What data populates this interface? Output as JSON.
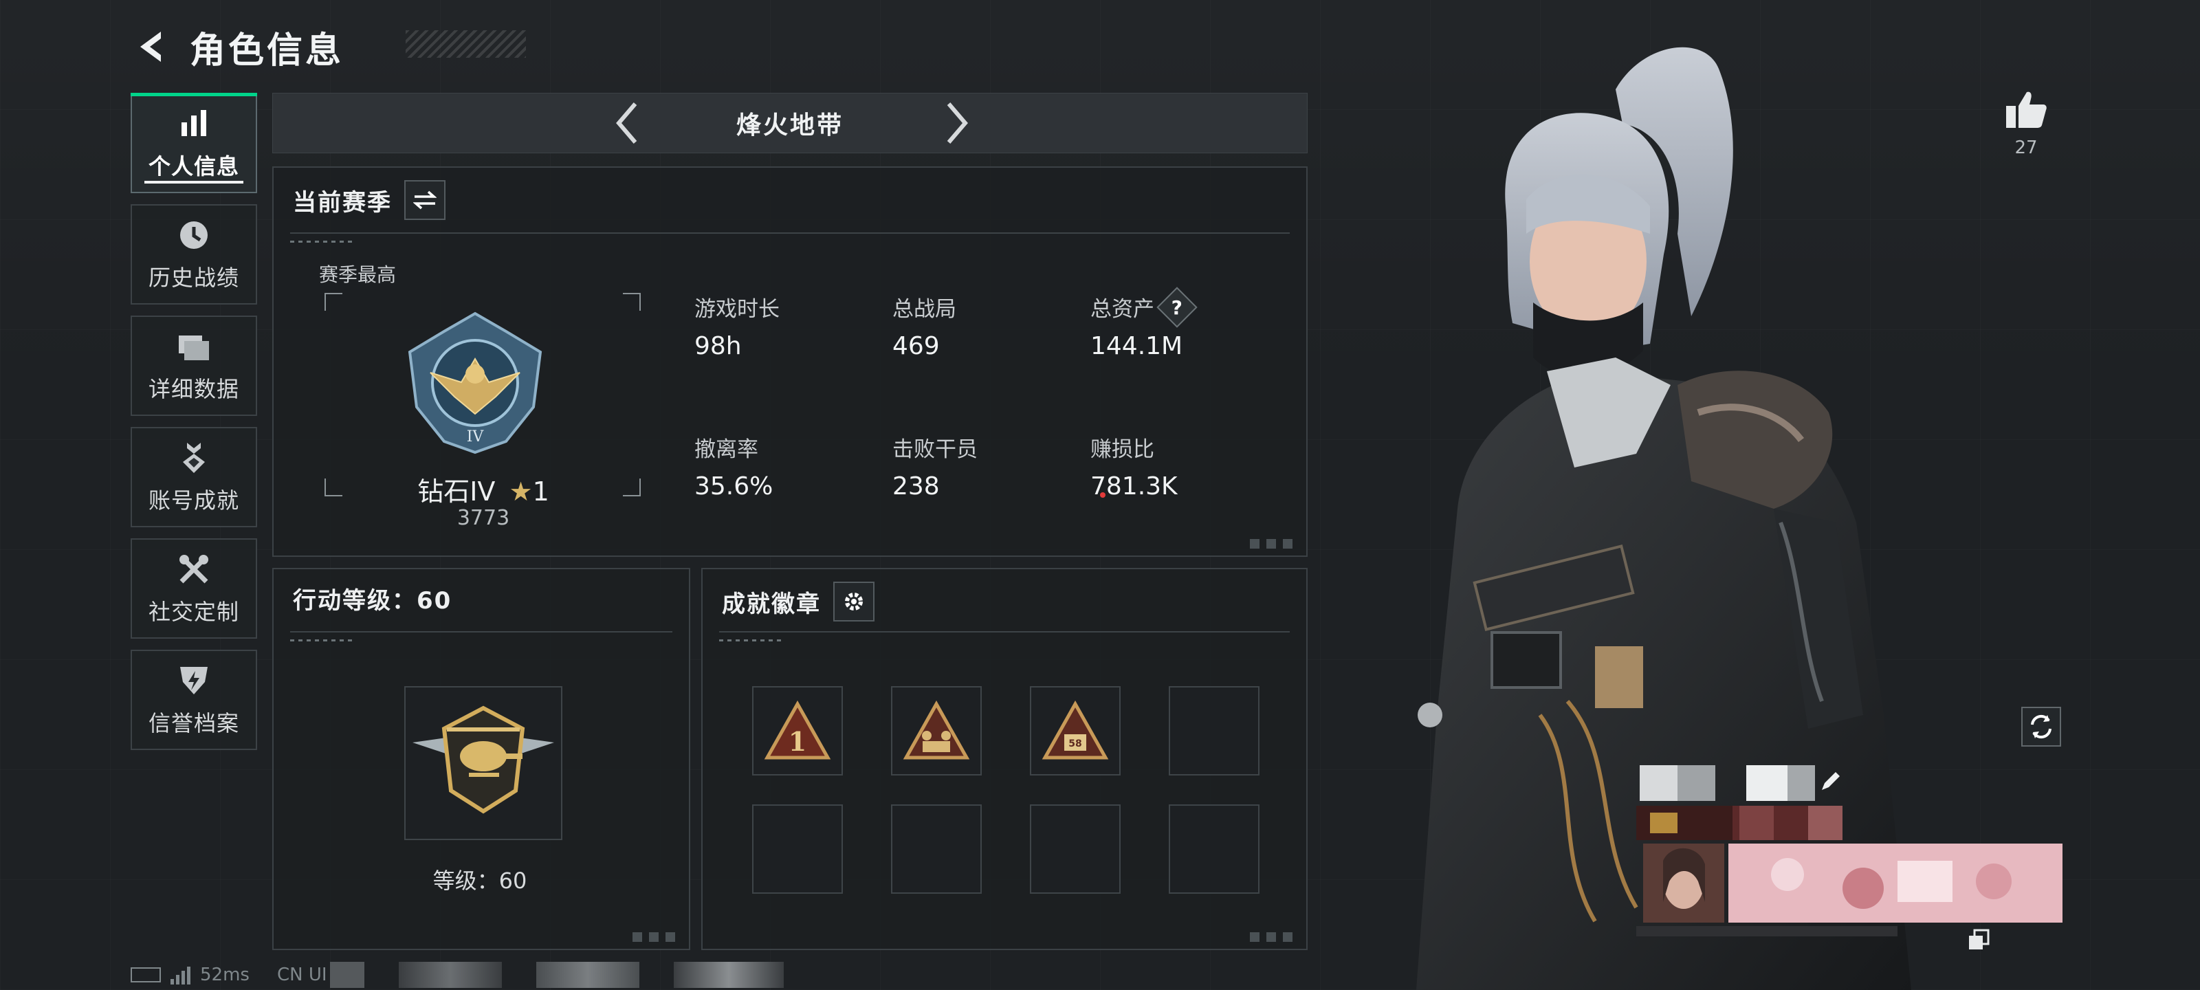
{
  "header": {
    "title": "角色信息",
    "back_icon": "back-arrow-icon"
  },
  "sidebar": {
    "items": [
      {
        "label": "个人信息",
        "icon": "bar-chart-icon",
        "active": true
      },
      {
        "label": "历史战绩",
        "icon": "clock-icon",
        "active": false
      },
      {
        "label": "详细数据",
        "icon": "folder-icon",
        "active": false
      },
      {
        "label": "账号成就",
        "icon": "medal-icon",
        "active": false
      },
      {
        "label": "社交定制",
        "icon": "wrench-icon",
        "active": false
      },
      {
        "label": "信誉档案",
        "icon": "shield-icon",
        "active": false
      }
    ]
  },
  "mode": {
    "title": "烽火地带"
  },
  "season": {
    "title": "当前赛季",
    "best_label": "赛季最高",
    "rank_name": "钻石IV",
    "rank_stars": "1",
    "rank_score": "3773",
    "stats": [
      {
        "label": "游戏时长",
        "value": "98h"
      },
      {
        "label": "总战局",
        "value": "469"
      },
      {
        "label": "总资产",
        "value": "144.1M",
        "help": "?"
      },
      {
        "label": "撤离率",
        "value": "35.6%"
      },
      {
        "label": "击败干员",
        "value": "238"
      },
      {
        "label": "赚损比",
        "value": "781.3K"
      }
    ]
  },
  "level": {
    "title": "行动等级：60",
    "label": "等级：60"
  },
  "badges": {
    "title": "成就徽章"
  },
  "profile": {
    "like_count": "27"
  },
  "status": {
    "ping": "52ms",
    "uid_prefix": "CN UI"
  },
  "colors": {
    "accent": "#00d48a",
    "bg": "#1e2124",
    "panel": "#1c1f22",
    "gold": "#c9a55c"
  }
}
